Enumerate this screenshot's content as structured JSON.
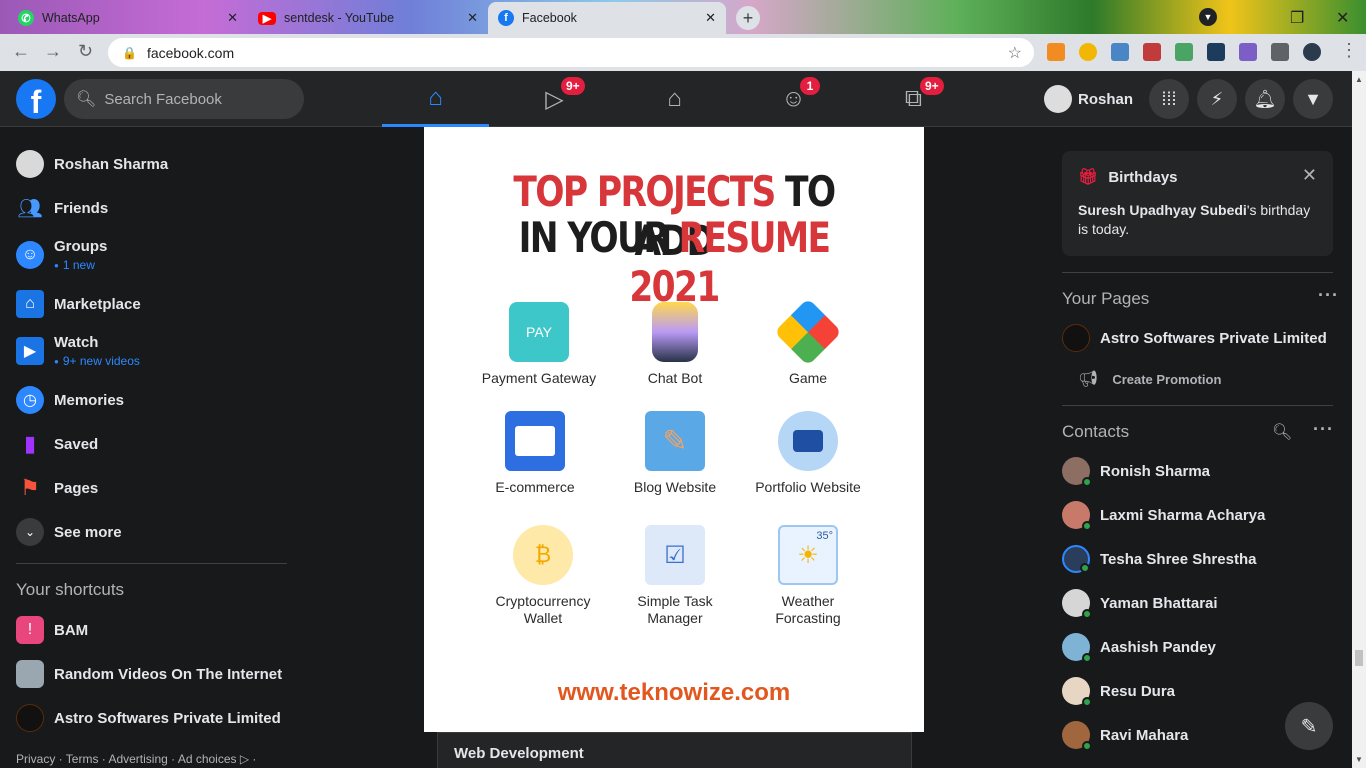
{
  "browser": {
    "tabs": [
      {
        "title": "WhatsApp",
        "icon": "whatsapp-icon",
        "color": "#25d366"
      },
      {
        "title": "sentdesk - YouTube",
        "icon": "youtube-icon",
        "color": "#ff0000"
      },
      {
        "title": "Facebook",
        "icon": "facebook-icon",
        "color": "#1877f2",
        "active": true
      }
    ],
    "url": "facebook.com"
  },
  "header": {
    "logo": "f",
    "search_placeholder": "Search Facebook",
    "nav": [
      {
        "name": "home",
        "icon": "home-icon",
        "badge": ""
      },
      {
        "name": "watch",
        "icon": "video-icon",
        "badge": "9+"
      },
      {
        "name": "marketplace",
        "icon": "store-icon",
        "badge": ""
      },
      {
        "name": "groups",
        "icon": "groups-icon",
        "badge": "1"
      },
      {
        "name": "gaming",
        "icon": "gaming-icon",
        "badge": "9+"
      }
    ],
    "profile_name": "Roshan"
  },
  "left_nav": {
    "items": [
      {
        "label": "Roshan Sharma",
        "sub": ""
      },
      {
        "label": "Friends",
        "sub": ""
      },
      {
        "label": "Groups",
        "sub": "1 new"
      },
      {
        "label": "Marketplace",
        "sub": ""
      },
      {
        "label": "Watch",
        "sub": "9+ new videos"
      },
      {
        "label": "Memories",
        "sub": ""
      },
      {
        "label": "Saved",
        "sub": ""
      },
      {
        "label": "Pages",
        "sub": ""
      },
      {
        "label": "See more",
        "sub": ""
      }
    ],
    "shortcuts_title": "Your shortcuts",
    "shortcuts": [
      "BAM",
      "Random Videos On The Internet",
      "Astro Softwares Private Limited"
    ],
    "footer": "Privacy · Terms · Advertising · Ad choices ▷ ·"
  },
  "post": {
    "headline_line1_red": "TOP PROJECTS",
    "headline_line1_dark": " TO ADD",
    "headline_line2_dark": "IN YOUR ",
    "headline_line2_red": "RESUME 2021",
    "projects": [
      {
        "label": "Payment Gateway",
        "icon": "payment-icon"
      },
      {
        "label": "Chat Bot",
        "icon": "chatbot-icon"
      },
      {
        "label": "Game",
        "icon": "cube-icon"
      },
      {
        "label": "E-commerce",
        "icon": "ecommerce-icon"
      },
      {
        "label": "Blog Website",
        "icon": "blog-icon"
      },
      {
        "label": "Portfolio Website",
        "icon": "portfolio-icon"
      },
      {
        "label": "Cryptocurrency Wallet",
        "icon": "wallet-icon"
      },
      {
        "label": "Simple Task Manager",
        "icon": "task-icon"
      },
      {
        "label": "Weather Forcasting",
        "icon": "weather-icon"
      }
    ],
    "weather_temp": "35°",
    "url": "www.teknowize.com",
    "footer_label": "Web Development"
  },
  "right_rail": {
    "birthdays_title": "Birthdays",
    "birthday_name": "Suresh Upadhyay Subedi",
    "birthday_suffix": "'s birthday is today.",
    "your_pages_title": "Your Pages",
    "page_name": "Astro Softwares Private Limited",
    "create_promotion": "Create Promotion",
    "contacts_title": "Contacts",
    "contacts": [
      "Ronish Sharma",
      "Laxmi Sharma Acharya",
      "Tesha Shree Shrestha",
      "Yaman Bhattarai",
      "Aashish Pandey",
      "Resu Dura",
      "Ravi Mahara"
    ]
  }
}
